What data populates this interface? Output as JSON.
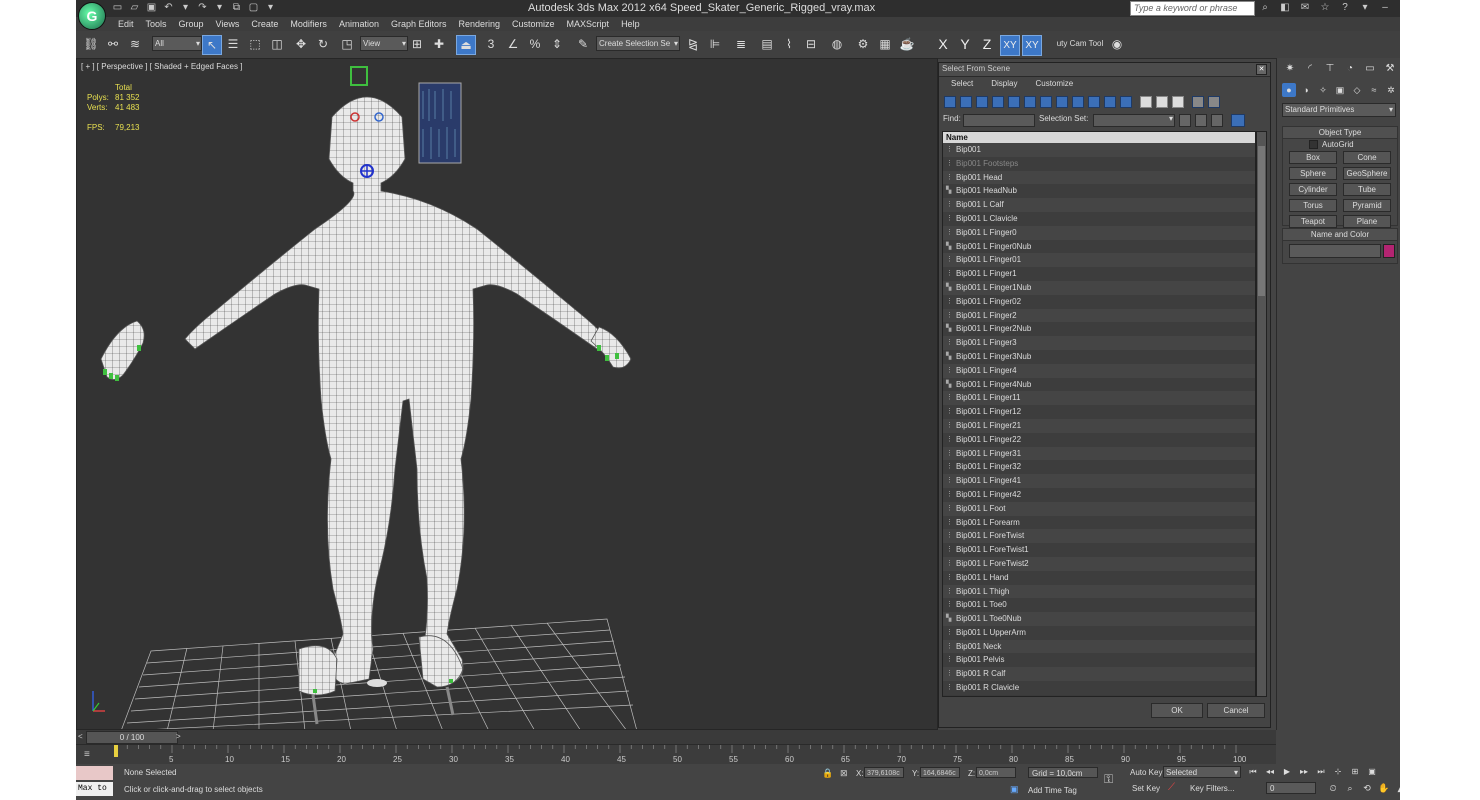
{
  "title": "Autodesk 3ds Max  2012 x64     Speed_Skater_Generic_Rigged_vray.max",
  "search_placeholder": "Type a keyword or phrase",
  "menu": [
    "Edit",
    "Tools",
    "Group",
    "Views",
    "Create",
    "Modifiers",
    "Animation",
    "Graph Editors",
    "Rendering",
    "Customize",
    "MAXScript",
    "Help"
  ],
  "toolbar": {
    "filter_value": "All",
    "view_value": "View",
    "selset_value": "Create Selection Se",
    "snap_label": "3",
    "axes": [
      "X",
      "Y",
      "Z",
      "XY",
      "XY"
    ],
    "cam_tool_label": "uty Cam Tool"
  },
  "viewport": {
    "label": "[ + ] [ Perspective ] [ Shaded + Edged Faces ]",
    "stats": {
      "total_label": "Total",
      "polys_label": "Polys:",
      "polys_value": "81 352",
      "verts_label": "Verts:",
      "verts_value": "41 483",
      "fps_label": "FPS:",
      "fps_value": "79,213"
    }
  },
  "dialog": {
    "title": "Select From Scene",
    "menu": [
      "Select",
      "Display",
      "Customize"
    ],
    "find_label": "Find:",
    "selset_label": "Selection Set:",
    "column_name": "Name",
    "items": [
      "Bip001",
      "Bip001 Footsteps",
      "Bip001 Head",
      "Bip001 HeadNub",
      "Bip001 L Calf",
      "Bip001 L Clavicle",
      "Bip001 L Finger0",
      "Bip001 L Finger0Nub",
      "Bip001 L Finger01",
      "Bip001 L Finger1",
      "Bip001 L Finger1Nub",
      "Bip001 L Finger02",
      "Bip001 L Finger2",
      "Bip001 L Finger2Nub",
      "Bip001 L Finger3",
      "Bip001 L Finger3Nub",
      "Bip001 L Finger4",
      "Bip001 L Finger4Nub",
      "Bip001 L Finger11",
      "Bip001 L Finger12",
      "Bip001 L Finger21",
      "Bip001 L Finger22",
      "Bip001 L Finger31",
      "Bip001 L Finger32",
      "Bip001 L Finger41",
      "Bip001 L Finger42",
      "Bip001 L Foot",
      "Bip001 L Forearm",
      "Bip001 L ForeTwist",
      "Bip001 L ForeTwist1",
      "Bip001 L ForeTwist2",
      "Bip001 L Hand",
      "Bip001 L Thigh",
      "Bip001 L Toe0",
      "Bip001 L Toe0Nub",
      "Bip001 L UpperArm",
      "Bip001 Neck",
      "Bip001 Pelvis",
      "Bip001 R Calf",
      "Bip001 R Clavicle"
    ],
    "ok_label": "OK",
    "cancel_label": "Cancel"
  },
  "command_panel": {
    "dropdown": "Standard Primitives",
    "object_type_title": "Object Type",
    "autogrid_label": "AutoGrid",
    "primitives": [
      "Box",
      "Cone",
      "Sphere",
      "GeoSphere",
      "Cylinder",
      "Tube",
      "Torus",
      "Pyramid",
      "Teapot",
      "Plane"
    ],
    "name_color_title": "Name and Color",
    "object_color": "#b32471"
  },
  "timeline": {
    "slider_label": "0 / 100",
    "ticks": [
      "5",
      "10",
      "15",
      "20",
      "25",
      "30",
      "35",
      "40",
      "45",
      "50",
      "55",
      "60",
      "65",
      "70",
      "75",
      "80",
      "85",
      "90",
      "95",
      "100"
    ]
  },
  "status": {
    "listener_label": "Max to",
    "selection_status": "None Selected",
    "prompt": "Click or click-and-drag to select objects",
    "x_label": "X:",
    "x_value": "379,6108c",
    "y_label": "Y:",
    "y_value": "164,6846c",
    "z_label": "Z:",
    "z_value": "0,0cm",
    "grid": "Grid = 10,0cm",
    "add_time_tag": "Add Time Tag",
    "auto_key": "Auto Key",
    "set_key": "Set Key",
    "key_mode": "Selected",
    "key_filters": "Key Filters...",
    "frame_value": "0"
  }
}
